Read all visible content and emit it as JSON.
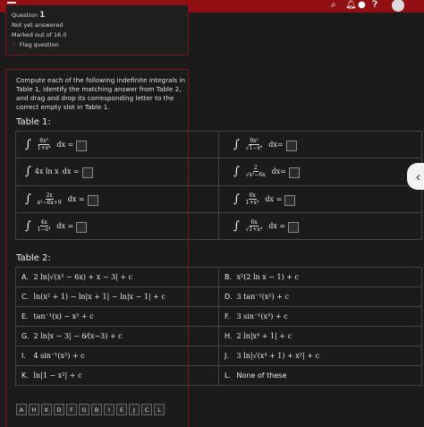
{
  "topbar": {
    "icons": [
      "menu-icon",
      "search-icon",
      "notification-icon",
      "chat-icon",
      "help-icon",
      "user-avatar"
    ]
  },
  "question": {
    "label": "Question",
    "number": "1",
    "status": "Not yet answered",
    "marks": "Marked out of 16.0",
    "flag": "Flag question"
  },
  "prompt": "Compute each of the following indefinite integrals in Table 1, identify the matching answer from Table 2, and drag and drop its corresponding letter to the correct empty slot in Table 1.",
  "table1": {
    "title": "Table 1:",
    "rows": [
      [
        {
          "pre": "",
          "num": "8x³",
          "den": "1+x⁴",
          "sqrt": false,
          "dx": "dx ="
        },
        {
          "pre": "",
          "num": "9x²",
          "den": "1−x⁶",
          "sqrt": true,
          "dx": "dx="
        }
      ],
      [
        {
          "pre": "4x ln x",
          "num": "",
          "den": "",
          "sqrt": false,
          "dx": "dx ="
        },
        {
          "pre": "",
          "num": "2",
          "den": "x²−6x",
          "sqrt": true,
          "dx": "dx="
        }
      ],
      [
        {
          "pre": "",
          "num": "2x",
          "den": "x²−6x+9",
          "sqrt": false,
          "dx": "dx ="
        },
        {
          "pre": "",
          "num": "6x",
          "den": "1+x⁴",
          "sqrt": false,
          "dx": "dx ="
        }
      ],
      [
        {
          "pre": "",
          "num": "4x",
          "den": "1−x⁴",
          "sqrt": false,
          "dx": "dx ="
        },
        {
          "pre": "",
          "num": "6x",
          "den": "1+x⁴",
          "sqrt": true,
          "dx": "dx ="
        }
      ]
    ]
  },
  "table2": {
    "title": "Table 2:",
    "rows": [
      [
        {
          "letter": "A.",
          "text": "2 ln|√(x² − 6x) + x − 3| + c"
        },
        {
          "letter": "B.",
          "text": "x²(2 ln x − 1) + c"
        }
      ],
      [
        {
          "letter": "C.",
          "text": "ln(x² + 1) − ln|x + 1| − ln|x − 1| + c"
        },
        {
          "letter": "D.",
          "text": "3 tan⁻¹(x²) + c"
        }
      ],
      [
        {
          "letter": "E.",
          "text": "tan⁻¹(x) − x² + c"
        },
        {
          "letter": "F.",
          "text": "3 sin⁻¹(x³) + c"
        }
      ],
      [
        {
          "letter": "G.",
          "text": "2 ln|x − 3| − 6⁄(x−3) + c"
        },
        {
          "letter": "H.",
          "text": "2 ln|x⁴ + 1| + c"
        }
      ],
      [
        {
          "letter": "I.",
          "text": "4 sin⁻¹(x²) + c"
        },
        {
          "letter": "J.",
          "text": "3 ln|√(x⁴ + 1) + x²| + c"
        }
      ],
      [
        {
          "letter": "K.",
          "text": "ln|1 − x²| + c"
        },
        {
          "letter": "L.",
          "text": "None of these",
          "plain": true
        }
      ]
    ]
  },
  "drag_items": [
    "A",
    "H",
    "K",
    "D",
    "F",
    "G",
    "B",
    "I",
    "E",
    "J",
    "C",
    "L"
  ],
  "colors": {
    "topbar": "#8f0f12",
    "panel_border": "#7c1416",
    "background": "#1b1b1b"
  }
}
